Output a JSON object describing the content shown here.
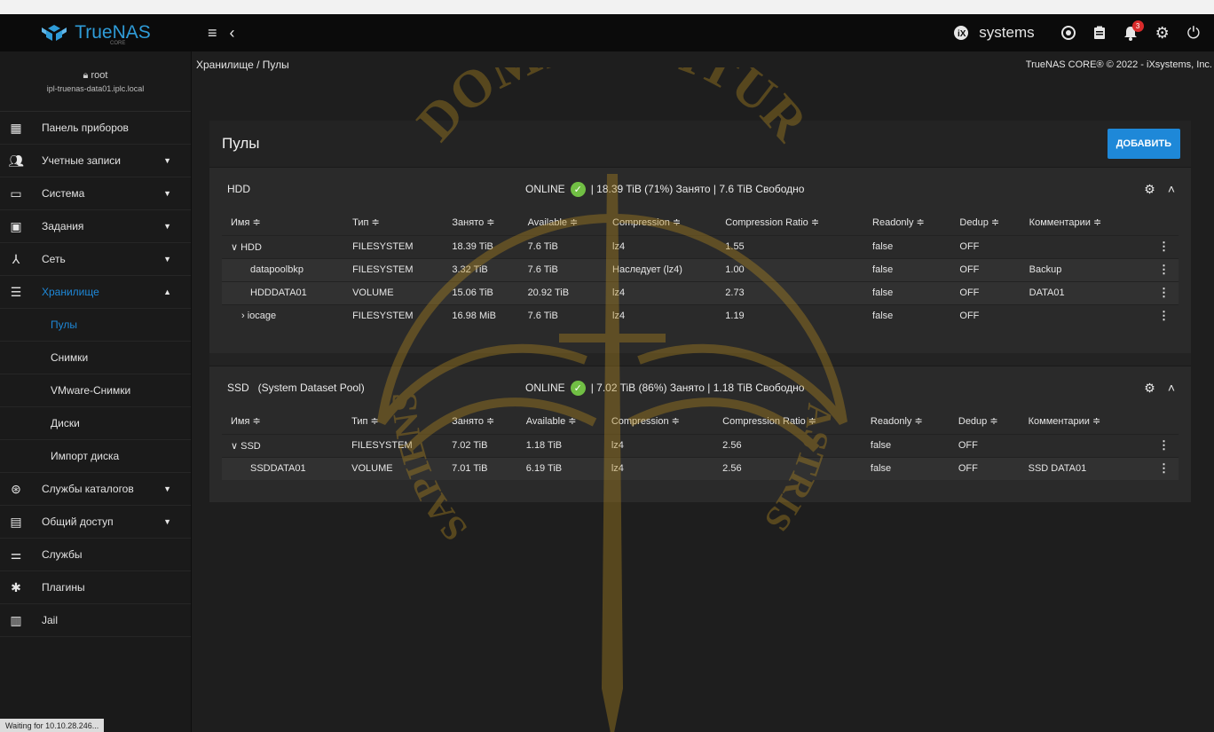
{
  "app": {
    "logo_text": "TrueNAS",
    "logo_sub": "CORE"
  },
  "topbar": {
    "vendor": "systems",
    "notification_count": "3"
  },
  "user": {
    "name": "root",
    "host": "ipl-truenas-data01.iplc.local"
  },
  "sidebar": {
    "items": [
      {
        "label": "Панель приборов",
        "icon": "dashboard-icon"
      },
      {
        "label": "Учетные записи",
        "icon": "accounts-icon"
      },
      {
        "label": "Система",
        "icon": "system-icon"
      },
      {
        "label": "Задания",
        "icon": "tasks-icon"
      },
      {
        "label": "Сеть",
        "icon": "network-icon"
      },
      {
        "label": "Хранилище",
        "icon": "storage-icon"
      }
    ],
    "storage_sub": [
      "Пулы",
      "Снимки",
      "VMware-Снимки",
      "Диски",
      "Импорт диска"
    ],
    "items2": [
      {
        "label": "Службы каталогов",
        "icon": "directory-services-icon"
      },
      {
        "label": "Общий доступ",
        "icon": "sharing-icon"
      },
      {
        "label": "Службы",
        "icon": "services-icon"
      },
      {
        "label": "Плагины",
        "icon": "plugins-icon"
      },
      {
        "label": "Jail",
        "icon": "jail-icon"
      }
    ]
  },
  "status_bar": "Waiting for 10.10.28.246...",
  "breadcrumb": "Хранилище / Пулы",
  "copyright": "TrueNAS CORE® © 2022 - iXsystems, Inc.",
  "pools": {
    "title": "Пулы",
    "add_label": "ДОБАВИТЬ",
    "columns": [
      "Имя ≑",
      "Тип ≑",
      "Занято ≑",
      "Available ≑",
      "Compression ≑",
      "Compression Ratio ≑",
      "Readonly ≑",
      "Dedup ≑",
      "Комментарии ≑"
    ],
    "hdd": {
      "name": "HDD",
      "status": "ONLINE",
      "usage": "| 18.39 TiB (71%) Занято | 7.6 TiB Свободно",
      "rows": [
        [
          "∨ HDD",
          "FILESYSTEM",
          "18.39 TiB",
          "7.6 TiB",
          "lz4",
          "1.55",
          "false",
          "OFF",
          ""
        ],
        [
          "datapoolbkp",
          "FILESYSTEM",
          "3.32 TiB",
          "7.6 TiB",
          "Наследует (lz4)",
          "1.00",
          "false",
          "OFF",
          "Backup"
        ],
        [
          "HDDDATA01",
          "VOLUME",
          "15.06 TiB",
          "20.92 TiB",
          "lz4",
          "2.73",
          "false",
          "OFF",
          "DATA01"
        ],
        [
          "› iocage",
          "FILESYSTEM",
          "16.98 MiB",
          "7.6 TiB",
          "lz4",
          "1.19",
          "false",
          "OFF",
          ""
        ]
      ]
    },
    "ssd": {
      "name": "SSD   (System Dataset Pool)",
      "status": "ONLINE",
      "usage": "| 7.02 TiB (86%) Занято | 1.18 TiB Свободно",
      "rows": [
        [
          "∨ SSD",
          "FILESYSTEM",
          "7.02 TiB",
          "1.18 TiB",
          "lz4",
          "2.56",
          "false",
          "OFF",
          ""
        ],
        [
          "SSDDATA01",
          "VOLUME",
          "7.01 TiB",
          "6.19 TiB",
          "lz4",
          "2.56",
          "false",
          "OFF",
          "SSD DATA01"
        ]
      ]
    }
  },
  "watermark": {
    "top_text": "DOMINABITUR",
    "left_text": "SAPIENS",
    "right_text": "ASTRIS",
    "color": "#b58a1f"
  }
}
